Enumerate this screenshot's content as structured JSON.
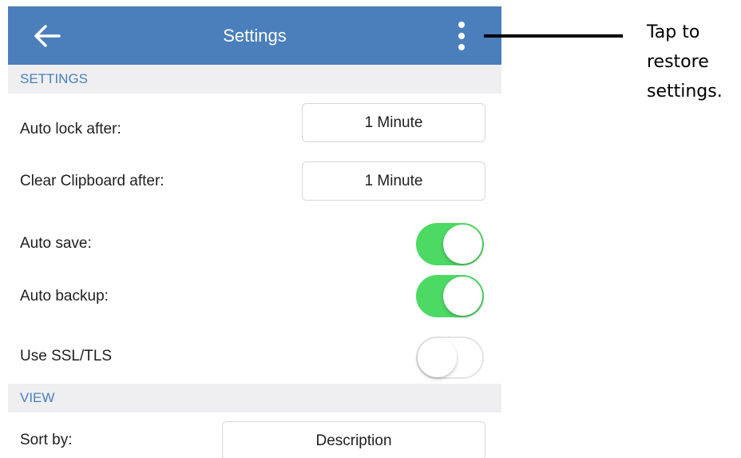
{
  "appbar": {
    "title": "Settings",
    "back_icon": "arrow-left-icon",
    "menu_icon": "more-vertical-icon",
    "color": "#4a7fbc"
  },
  "sections": {
    "settings": "SETTINGS",
    "view": "VIEW"
  },
  "rows": {
    "auto_lock": {
      "label": "Auto lock after:",
      "value": "1 Minute"
    },
    "clear_clipboard": {
      "label": "Clear Clipboard after:",
      "value": "1 Minute"
    },
    "auto_save": {
      "label": "Auto save:",
      "on": true
    },
    "auto_backup": {
      "label": "Auto backup:",
      "on": true
    },
    "use_ssl": {
      "label": "Use SSL/TLS",
      "on": false
    },
    "sort_by": {
      "label": "Sort by:",
      "value": "Description"
    }
  },
  "toggle_on_color": "#4cd964",
  "annotation": {
    "lines": [
      "Tap to",
      "restore",
      "settings."
    ]
  }
}
